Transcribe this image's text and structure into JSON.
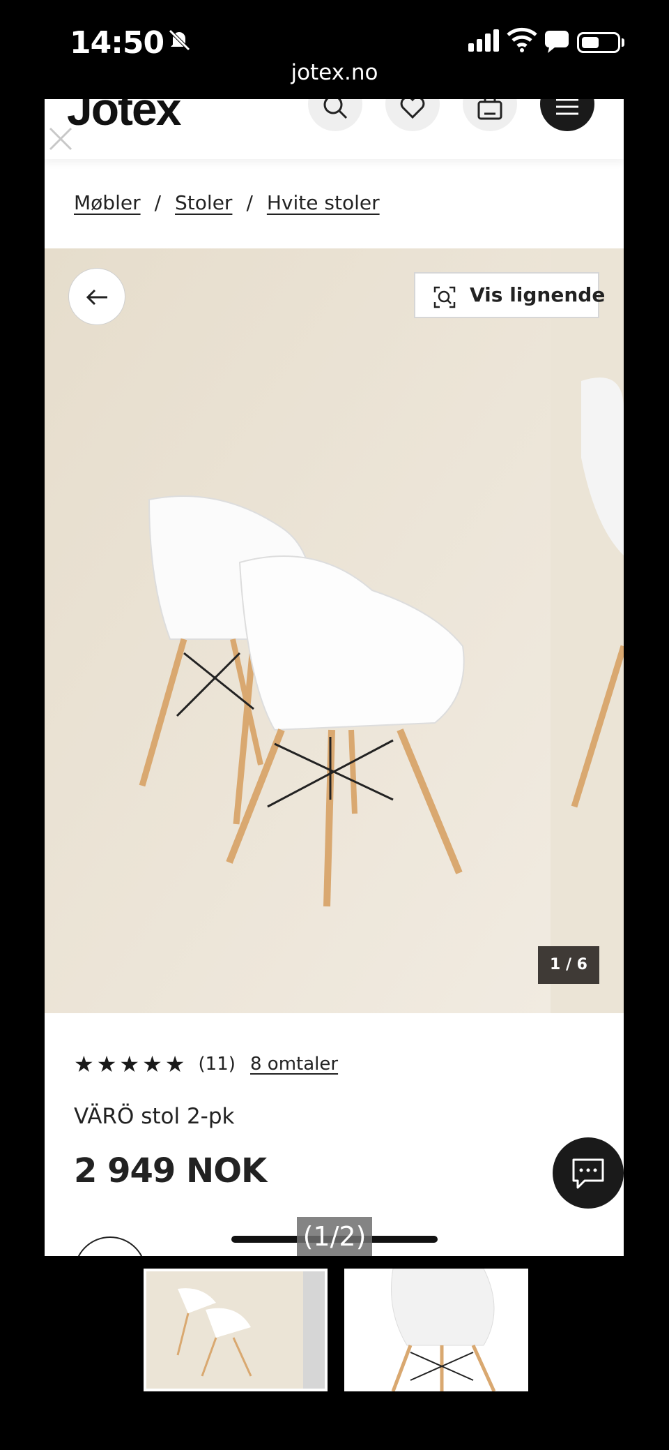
{
  "status_bar": {
    "time": "14:50",
    "url": "jotex.no"
  },
  "header": {
    "logo": "Jotex"
  },
  "breadcrumb": {
    "items": [
      "Møbler",
      "Stoler",
      "Hvite stoler"
    ],
    "separator": "/"
  },
  "gallery": {
    "similar_label": "Vis lignende",
    "counter": "1 / 6"
  },
  "product": {
    "stars": "★★★★★",
    "rating_count": "(11)",
    "reviews_link": "8 omtaler",
    "name": "VÄRÖ stol 2-pk",
    "price": "2 949 NOK"
  },
  "viewer": {
    "page_indicator": "(1/2)"
  },
  "colors": {
    "accent_dark": "#1a1a1a",
    "gallery_bg": "#ebe4d6",
    "wood": "#d9a870"
  }
}
